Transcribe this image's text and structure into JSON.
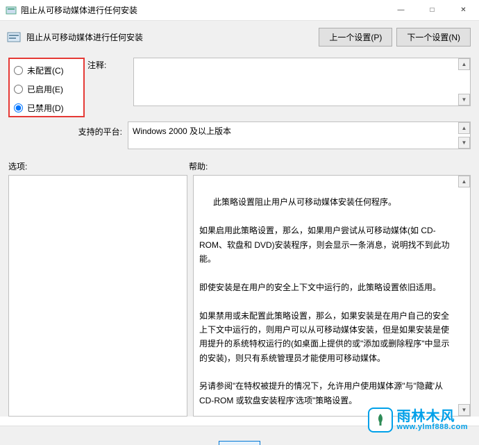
{
  "window": {
    "title": "阻止从可移动媒体进行任何安装",
    "minimize": "—",
    "maximize": "□",
    "close": "✕"
  },
  "header": {
    "title": "阻止从可移动媒体进行任何安装",
    "prev_button": "上一个设置(P)",
    "next_button": "下一个设置(N)"
  },
  "radios": {
    "not_configured": "未配置(C)",
    "enabled": "已启用(E)",
    "disabled": "已禁用(D)",
    "selected": "disabled"
  },
  "labels": {
    "comment": "注释:",
    "supported": "支持的平台:",
    "options": "选项:",
    "help": "帮助:"
  },
  "supported_text": "Windows 2000 及以上版本",
  "help_text": "此策略设置阻止用户从可移动媒体安装任何程序。\n\n如果启用此策略设置，那么，如果用户尝试从可移动媒体(如 CD-ROM、软盘和 DVD)安装程序，则会显示一条消息，说明找不到此功能。\n\n即使安装是在用户的安全上下文中运行的，此策略设置依旧适用。\n\n如果禁用或未配置此策略设置，那么，如果安装是在用户自己的安全上下文中运行的，则用户可以从可移动媒体安装，但是如果安装是使用提升的系统特权运行的(如桌面上提供的或\"添加或删除程序\"中显示的安装)，则只有系统管理员才能使用可移动媒体。\n\n另请参阅\"在特权被提升的情况下，允许用户使用媒体源\"与\"隐藏'从CD-ROM 或软盘安装程序'选项\"策略设置。",
  "watermark": {
    "cn": "雨林木风",
    "url": "www.ylmf888.com"
  }
}
